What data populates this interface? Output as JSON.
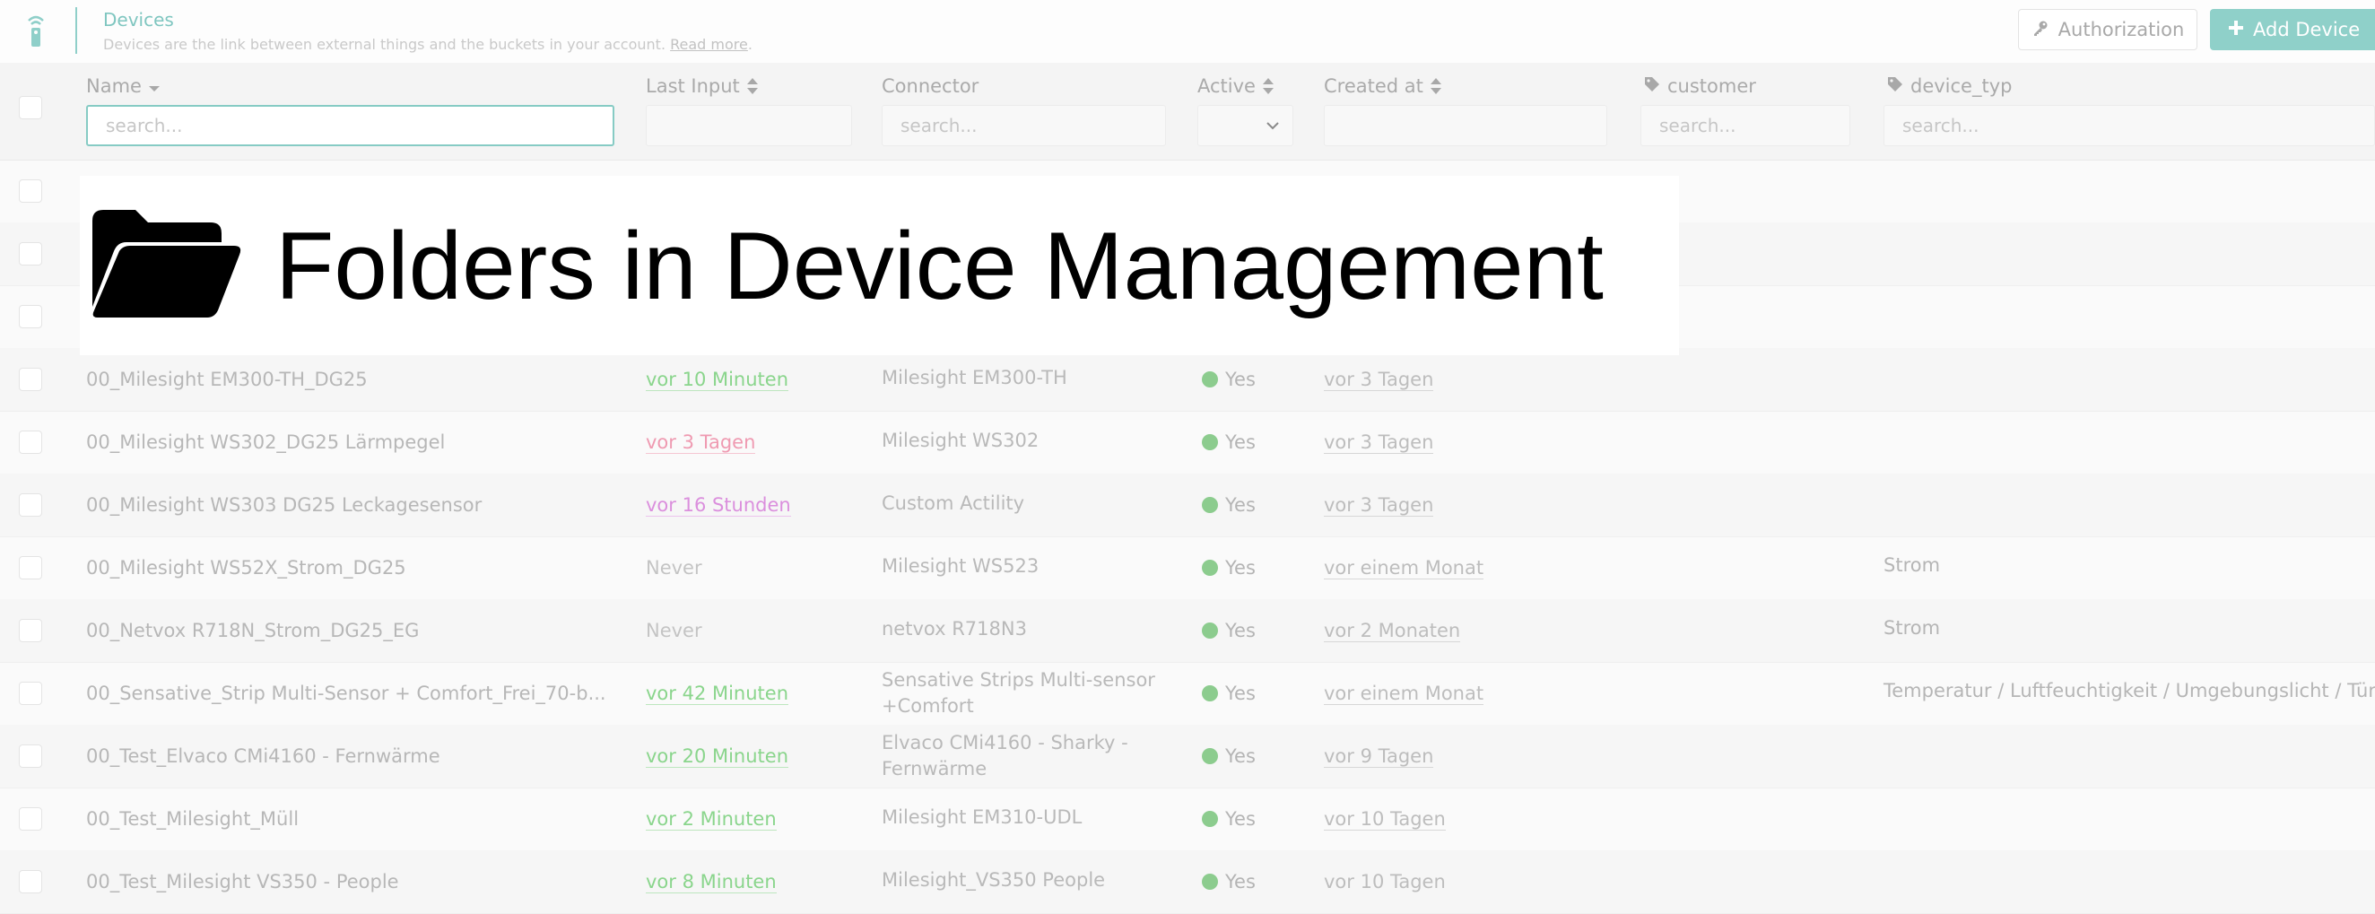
{
  "header": {
    "title": "Devices",
    "subtitle": "Devices are the link between external things and the buckets in your account.",
    "read_more": "Read more",
    "authorization_label": "Authorization",
    "add_device_label": "Add Device"
  },
  "columns": {
    "name": "Name",
    "last_input": "Last Input",
    "connector": "Connector",
    "active": "Active",
    "created_at": "Created at",
    "customer": "customer",
    "device_type": "device_typ"
  },
  "search": {
    "placeholder": "search..."
  },
  "banner": {
    "text": "Folders in Device Management"
  },
  "rows": [
    {
      "name": "00_Milesight EM300-TH_DG25",
      "last_input": "vor 10 Minuten",
      "connector": "Milesight EM300-TH",
      "connector2": "",
      "active": "Yes",
      "created": "vor 3 Tagen",
      "device_type": ""
    },
    {
      "name": "00_Milesight WS302_DG25 Lärmpegel",
      "last_input": "vor 3 Tagen",
      "connector": "Milesight WS302",
      "connector2": "",
      "active": "Yes",
      "created": "vor 3 Tagen",
      "device_type": ""
    },
    {
      "name": "00_Milesight WS303 DG25 Leckagesensor",
      "last_input": "vor 16 Stunden",
      "connector": "Custom Actility",
      "connector2": "",
      "active": "Yes",
      "created": "vor 3 Tagen",
      "device_type": ""
    },
    {
      "name": "00_Milesight WS52X_Strom_DG25",
      "last_input": "Never",
      "connector": "Milesight WS523",
      "connector2": "",
      "active": "Yes",
      "created": "vor einem Monat",
      "device_type": "Strom"
    },
    {
      "name": "00_Netvox R718N_Strom_DG25_EG",
      "last_input": "Never",
      "connector": "netvox R718N3",
      "connector2": "",
      "active": "Yes",
      "created": "vor 2 Monaten",
      "device_type": "Strom"
    },
    {
      "name": "00_Sensative_Strip Multi-Sensor + Comfort_Frei_70-b...",
      "last_input": "vor 42 Minuten",
      "connector": "Sensative Strips Multi-sensor",
      "connector2": "+Comfort",
      "active": "Yes",
      "created": "vor einem Monat",
      "device_type": "Temperatur / Luftfeuchtigkeit / Umgebungslicht / Tür..."
    },
    {
      "name": "00_Test_Elvaco CMi4160 - Fernwärme",
      "last_input": "vor 20 Minuten",
      "connector": "Elvaco CMi4160 - Sharky -",
      "connector2": "Fernwärme",
      "active": "Yes",
      "created": "vor 9 Tagen",
      "device_type": ""
    },
    {
      "name": "00_Test_Milesight_Müll",
      "last_input": "vor 2 Minuten",
      "connector": "Milesight EM310-UDL",
      "connector2": "",
      "active": "Yes",
      "created": "vor 10 Tagen",
      "device_type": ""
    },
    {
      "name": "00_Test_Milesight VS350 - People",
      "last_input": "vor 8 Minuten",
      "connector": "Milesight_VS350 People",
      "connector2": "",
      "active": "Yes",
      "created": "vor 10 Tagen",
      "device_type": ""
    }
  ]
}
